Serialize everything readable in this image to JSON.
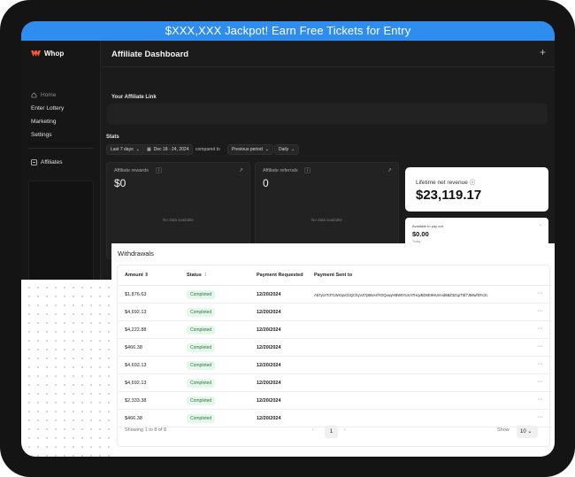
{
  "banner": {
    "text": "$XXX,XXX Jackpot!  Earn Free Tickets for Entry"
  },
  "app": {
    "name": "Whop"
  },
  "sidebar": {
    "items": [
      {
        "label": "Home"
      },
      {
        "label": "Enter Lottery"
      },
      {
        "label": "Marketing"
      },
      {
        "label": "Settings"
      },
      {
        "label": "Affiliates"
      }
    ]
  },
  "header": {
    "title": "Affiliate Dashboard",
    "add_label": "+"
  },
  "affiliate_link": {
    "label": "Your Affiliate Link"
  },
  "stats": {
    "label": "Stats",
    "range": "Last 7 days",
    "dates": "Dec 18 - 24, 2024",
    "compared_to": "compared to",
    "compare_period": "Previous period",
    "interval": "Daily"
  },
  "cards": [
    {
      "title": "Affiliate rewards",
      "value": "$0",
      "empty": "No data available"
    },
    {
      "title": "Affiliate referrals",
      "value": "0",
      "empty": "No data available"
    }
  ],
  "lifetime": {
    "title": "Lifetime net revenue",
    "value": "$23,119.17"
  },
  "payout": {
    "title": "Available to pay out",
    "value": "$0.00",
    "sub": "Today"
  },
  "withdrawals": {
    "title": "Withdrawals",
    "columns": {
      "amount": "Amount",
      "status": "Status",
      "requested": "Payment Requested",
      "sent_to": "Payment Sent to"
    },
    "rows": [
      {
        "amount": "$1,876.63",
        "status": "Completed",
        "date": "12/20/2024",
        "sent_to": "A57yUrTdT1WGqvCbQChyVZ7pB6AsfYDQuuyHBW6YuXATHqvBD6E9HUmnd6BZ3Z1pT5f7J58wfSFc2c"
      },
      {
        "amount": "$4,692.13",
        "status": "Completed",
        "date": "12/20/2024",
        "sent_to": ""
      },
      {
        "amount": "$4,222.88",
        "status": "Completed",
        "date": "12/20/2024",
        "sent_to": ""
      },
      {
        "amount": "$466.38",
        "status": "Completed",
        "date": "12/20/2024",
        "sent_to": ""
      },
      {
        "amount": "$4,692.13",
        "status": "Completed",
        "date": "12/20/2024",
        "sent_to": ""
      },
      {
        "amount": "$4,692.13",
        "status": "Completed",
        "date": "12/20/2024",
        "sent_to": ""
      },
      {
        "amount": "$2,333.38",
        "status": "Completed",
        "date": "12/20/2024",
        "sent_to": ""
      },
      {
        "amount": "$466.38",
        "status": "Completed",
        "date": "12/20/2024",
        "sent_to": ""
      }
    ],
    "footer": {
      "showing": "Showing 1 to 8 of 8",
      "page": "1",
      "show_label": "Show",
      "page_size": "10"
    }
  },
  "colors": {
    "banner": "#2f8df0",
    "badge_text": "#1e7d3a",
    "badge_bg": "#e6f6ea",
    "logo": "#ff5a36"
  }
}
